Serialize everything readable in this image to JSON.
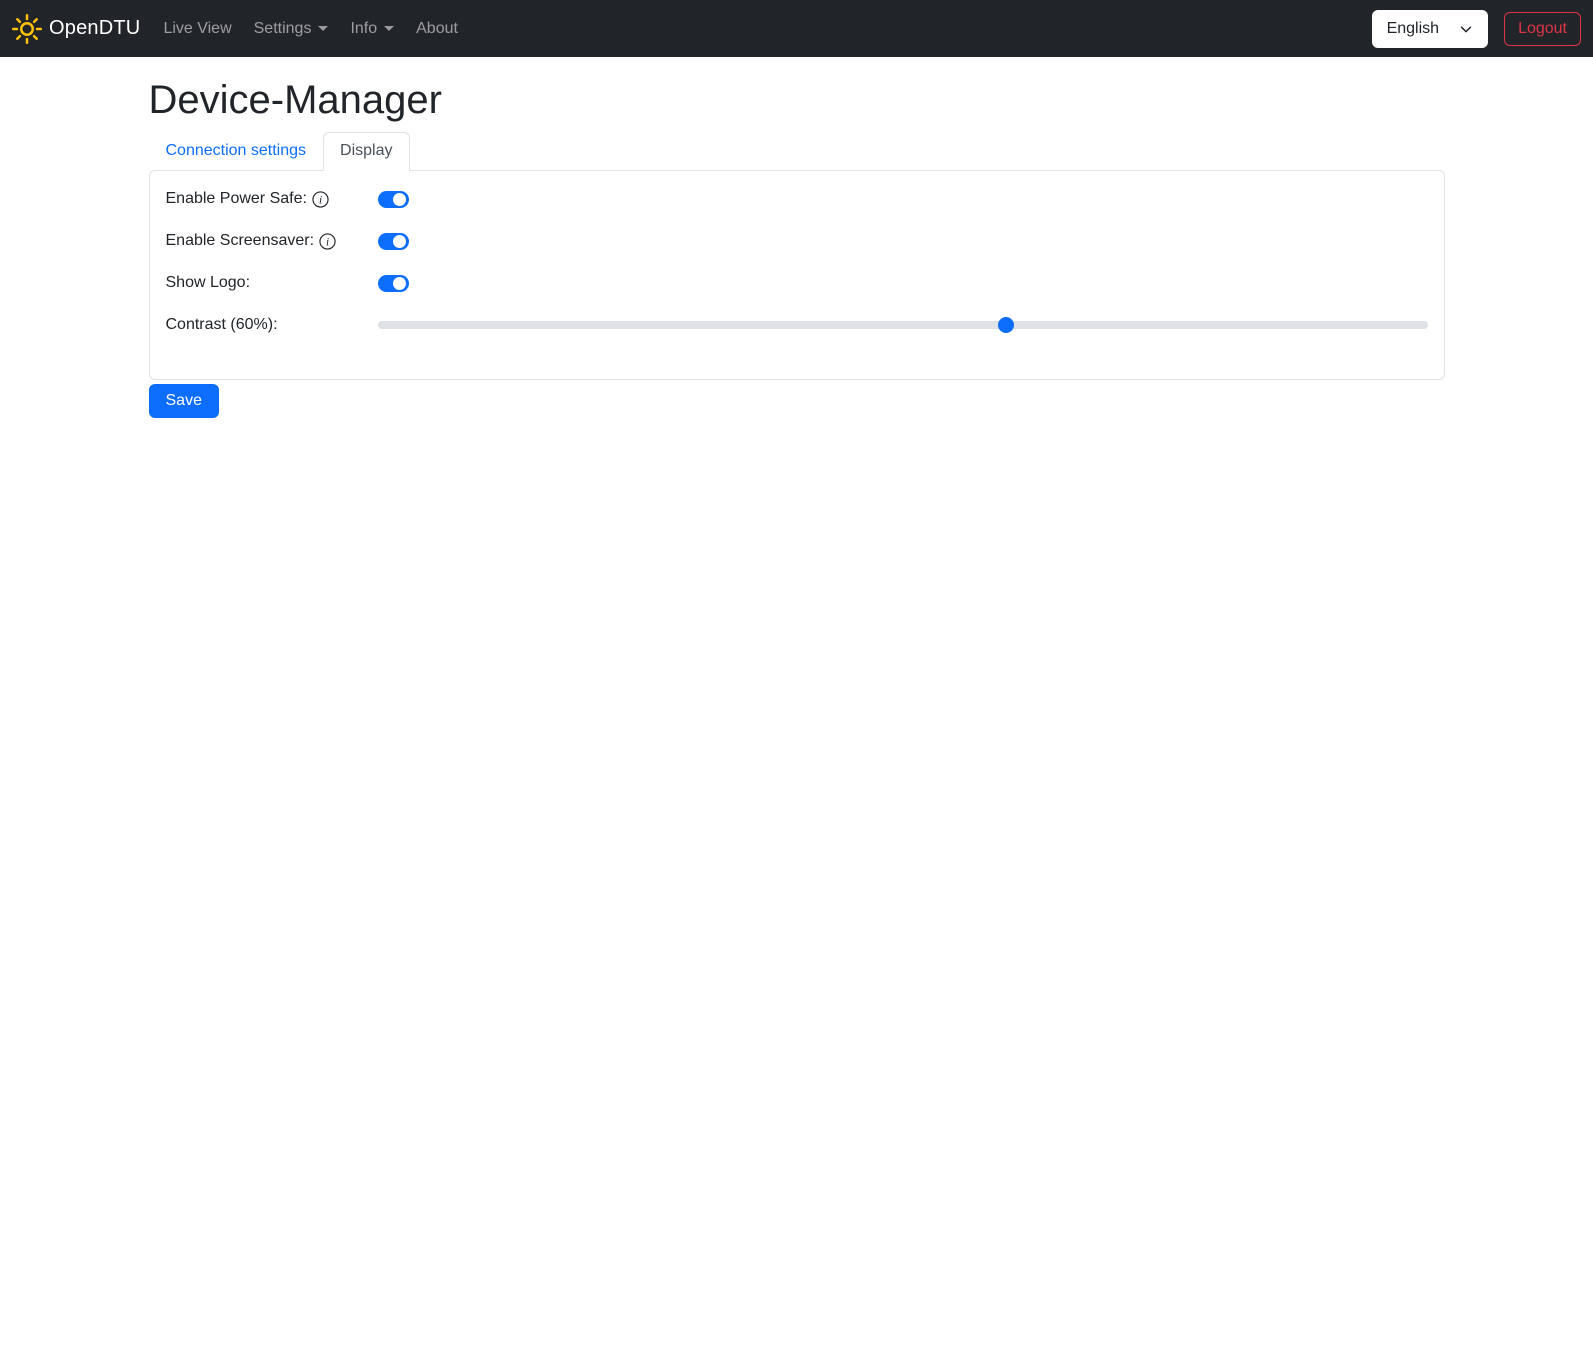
{
  "navbar": {
    "brand": "OpenDTU",
    "items": [
      {
        "label": "Live View",
        "dropdown": false
      },
      {
        "label": "Settings",
        "dropdown": true
      },
      {
        "label": "Info",
        "dropdown": true
      },
      {
        "label": "About",
        "dropdown": false
      }
    ],
    "language_selected": "English",
    "logout_label": "Logout"
  },
  "page": {
    "title": "Device-Manager",
    "tabs": [
      {
        "label": "Connection settings",
        "active": false
      },
      {
        "label": "Display",
        "active": true
      }
    ]
  },
  "settings": {
    "rows": [
      {
        "label": "Enable Power Safe:",
        "info": true,
        "type": "toggle",
        "value": true
      },
      {
        "label": "Enable Screensaver:",
        "info": true,
        "type": "toggle",
        "value": true
      },
      {
        "label": "Show Logo:",
        "info": false,
        "type": "toggle",
        "value": true
      },
      {
        "label": "Contrast (60%):",
        "info": false,
        "type": "slider",
        "value": 60,
        "min": 0,
        "max": 100
      }
    ],
    "save_label": "Save"
  },
  "icons": {
    "brand": "sun-icon",
    "dropdown": "caret-down-icon",
    "language": "chevron-down-icon",
    "tooltip": "info-circle-icon"
  },
  "colors": {
    "accent": "#0d6efd",
    "danger": "#dc3545",
    "navbar_bg": "#212529",
    "border": "#dee2e6",
    "brand_icon": "#ffc107",
    "nav_link": "rgba(255,255,255,0.55)"
  }
}
